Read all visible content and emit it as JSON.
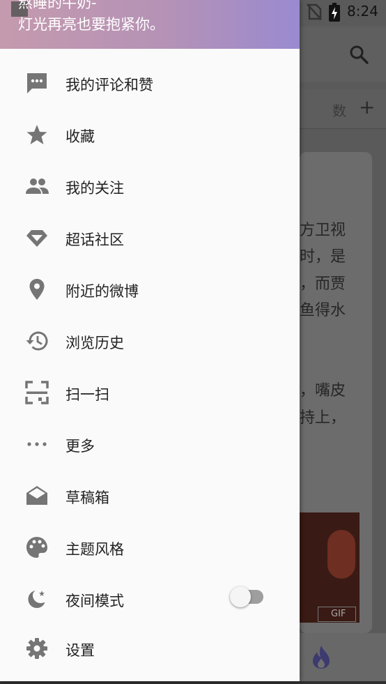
{
  "status_bar": {
    "time": "8:24"
  },
  "drawer": {
    "header": {
      "username": "熬睡的牛奶-",
      "bio": "灯光再亮也要抱紧你。"
    },
    "items": [
      {
        "label": "我的评论和赞",
        "icon": "comment-icon"
      },
      {
        "label": "收藏",
        "icon": "star-icon"
      },
      {
        "label": "我的关注",
        "icon": "people-icon"
      },
      {
        "label": "超话社区",
        "icon": "diamond-icon"
      },
      {
        "label": "附近的微博",
        "icon": "location-pin-icon"
      },
      {
        "label": "浏览历史",
        "icon": "history-icon"
      },
      {
        "label": "扫一扫",
        "icon": "scan-icon"
      },
      {
        "label": "更多",
        "icon": "more-dots-icon"
      },
      {
        "label": "草稿箱",
        "icon": "drafts-icon"
      },
      {
        "label": "主题风格",
        "icon": "palette-icon"
      },
      {
        "label": "夜间模式",
        "icon": "night-mode-icon",
        "toggle_on": false
      },
      {
        "label": "设置",
        "icon": "gear-icon"
      }
    ]
  },
  "background_app": {
    "tab_text": "数",
    "add_label": "+",
    "post_lines": [
      "方卫视",
      "时，是",
      "，而贾",
      "鱼得水",
      "，嘴皮",
      "持上，"
    ],
    "media_badge": "GIF"
  }
}
